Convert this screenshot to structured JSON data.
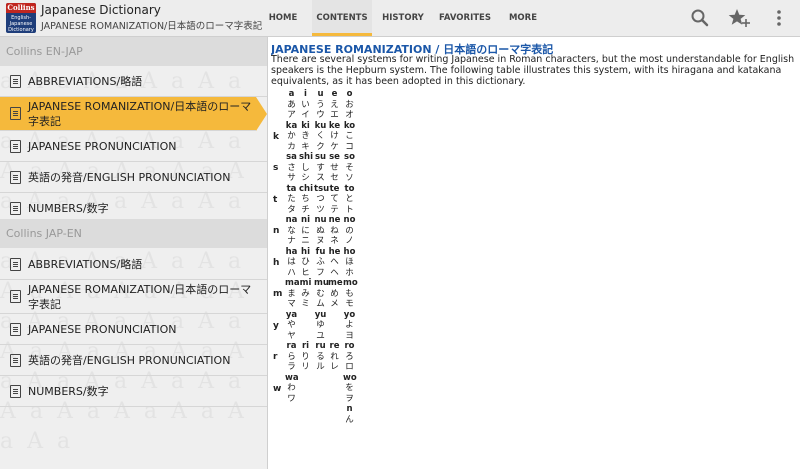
{
  "app": {
    "title": "Japanese Dictionary",
    "subtitle": "JAPANESE ROMANIZATION/日本語のローマ字表記",
    "icon_text": "Collins",
    "icon_sub": "English-Japanese Dictionary"
  },
  "tabs": [
    {
      "label": "HOME",
      "active": false
    },
    {
      "label": "CONTENTS",
      "active": true
    },
    {
      "label": "HISTORY",
      "active": false
    },
    {
      "label": "FAVORITES",
      "active": false
    },
    {
      "label": "MORE",
      "active": false
    }
  ],
  "toolbar_icons": [
    "search-icon",
    "add-favorite-star-icon",
    "overflow-menu-icon"
  ],
  "accent_color": "#f5b93c",
  "title_color": "#1b57a8",
  "sidebar": {
    "sections": [
      {
        "title": "Collins EN-JAP",
        "items": [
          {
            "label": "ABBREVIATIONS/略語"
          },
          {
            "label": "JAPANESE ROMANIZATION/日本語のローマ字表記",
            "active": true
          },
          {
            "label": "JAPANESE PRONUNCIATION"
          },
          {
            "label": "英語の発音/ENGLISH PRONUNCIATION"
          },
          {
            "label": "NUMBERS/数字"
          }
        ]
      },
      {
        "title": "Collins JAP-EN",
        "items": [
          {
            "label": "ABBREVIATIONS/略語"
          },
          {
            "label": "JAPANESE ROMANIZATION/日本語のローマ字表記"
          },
          {
            "label": "JAPANESE PRONUNCIATION"
          },
          {
            "label": "英語の発音/ENGLISH PRONUNCIATION"
          },
          {
            "label": "NUMBERS/数字"
          }
        ]
      }
    ]
  },
  "content": {
    "title": "JAPANESE ROMANIZATION / 日本語のローマ字表記",
    "paragraph": "There are several systems for writing Japanese in Roman characters, but the most understandable for English speakers is the Hepburn system. The following table illustrates this system, with its hiragana and katakana equivalents, as it has been adopted in this dictionary.",
    "table": {
      "columns": [
        "a",
        "i",
        "u",
        "e",
        "o"
      ],
      "rows": [
        {
          "label": "",
          "cells": [
            [
              "a",
              "あ",
              "ア"
            ],
            [
              "i",
              "い",
              "イ"
            ],
            [
              "u",
              "う",
              "ウ"
            ],
            [
              "e",
              "え",
              "エ"
            ],
            [
              "o",
              "お",
              "オ"
            ]
          ]
        },
        {
          "label": "k",
          "cells": [
            [
              "ka",
              "か",
              "カ"
            ],
            [
              "ki",
              "き",
              "キ"
            ],
            [
              "ku",
              "く",
              "ク"
            ],
            [
              "ke",
              "け",
              "ケ"
            ],
            [
              "ko",
              "こ",
              "コ"
            ]
          ]
        },
        {
          "label": "s",
          "cells": [
            [
              "sa",
              "さ",
              "サ"
            ],
            [
              "shi",
              "し",
              "シ"
            ],
            [
              "su",
              "す",
              "ス"
            ],
            [
              "se",
              "せ",
              "セ"
            ],
            [
              "so",
              "そ",
              "ソ"
            ]
          ]
        },
        {
          "label": "t",
          "cells": [
            [
              "ta",
              "た",
              "タ"
            ],
            [
              "chi",
              "ち",
              "チ"
            ],
            [
              "tsu",
              "つ",
              "ツ"
            ],
            [
              "te",
              "て",
              "テ"
            ],
            [
              "to",
              "と",
              "ト"
            ]
          ]
        },
        {
          "label": "n",
          "cells": [
            [
              "na",
              "な",
              "ナ"
            ],
            [
              "ni",
              "に",
              "ニ"
            ],
            [
              "nu",
              "ぬ",
              "ヌ"
            ],
            [
              "ne",
              "ね",
              "ネ"
            ],
            [
              "no",
              "の",
              "ノ"
            ]
          ]
        },
        {
          "label": "h",
          "cells": [
            [
              "ha",
              "は",
              "ハ"
            ],
            [
              "hi",
              "ひ",
              "ヒ"
            ],
            [
              "fu",
              "ふ",
              "フ"
            ],
            [
              "he",
              "へ",
              "ヘ"
            ],
            [
              "ho",
              "ほ",
              "ホ"
            ]
          ]
        },
        {
          "label": "m",
          "cells": [
            [
              "ma",
              "ま",
              "マ"
            ],
            [
              "mi",
              "み",
              "ミ"
            ],
            [
              "mu",
              "む",
              "ム"
            ],
            [
              "me",
              "め",
              "メ"
            ],
            [
              "mo",
              "も",
              "モ"
            ]
          ]
        },
        {
          "label": "y",
          "cells": [
            [
              "ya",
              "や",
              "ヤ"
            ],
            [
              "",
              "",
              " "
            ],
            [
              "yu",
              "ゆ",
              "ユ"
            ],
            [
              "",
              "",
              ""
            ],
            [
              "yo",
              "よ",
              "ヨ"
            ]
          ]
        },
        {
          "label": "r",
          "cells": [
            [
              "ra",
              "ら",
              "ラ"
            ],
            [
              "ri",
              "り",
              "リ"
            ],
            [
              "ru",
              "る",
              "ル"
            ],
            [
              "re",
              "れ",
              "レ"
            ],
            [
              "ro",
              "ろ",
              "ロ"
            ]
          ]
        },
        {
          "label": "w",
          "cells": [
            [
              "wa",
              "わ",
              "ワ"
            ],
            [
              "",
              "",
              ""
            ],
            [
              "",
              "",
              ""
            ],
            [
              "",
              "",
              ""
            ],
            [
              "wo",
              "を",
              "ヲ"
            ]
          ]
        },
        {
          "label": "",
          "cells": [
            [
              "",
              "",
              ""
            ],
            [
              "",
              "",
              ""
            ],
            [
              "",
              "",
              ""
            ],
            [
              "",
              "",
              ""
            ],
            [
              "n",
              "ん",
              ""
            ]
          ]
        }
      ]
    }
  }
}
